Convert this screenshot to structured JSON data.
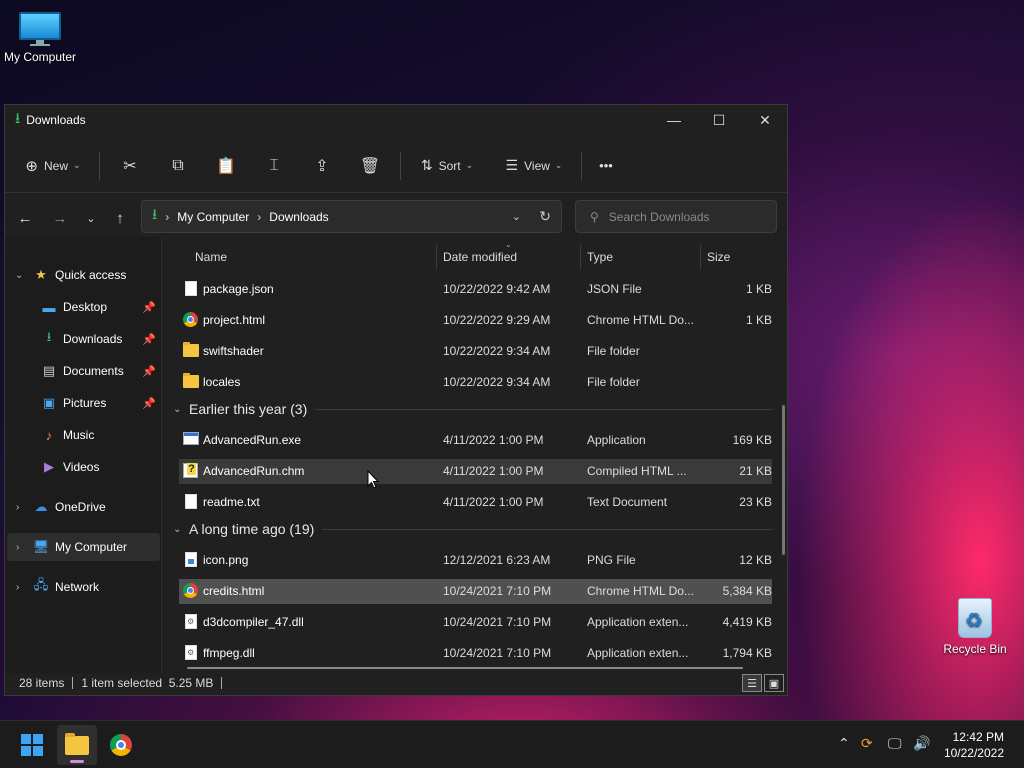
{
  "desktop": {
    "my_computer_label": "My Computer",
    "recycle_bin_label": "Recycle Bin"
  },
  "window": {
    "title": "Downloads",
    "controls": {
      "minimize": "—",
      "maximize": "☐",
      "close": "✕"
    }
  },
  "toolbar": {
    "new_label": "New",
    "sort_label": "Sort",
    "view_label": "View",
    "more_label": "•••"
  },
  "address": {
    "crumbs": [
      "My Computer",
      "Downloads"
    ],
    "separator": "›"
  },
  "search": {
    "placeholder": "Search Downloads"
  },
  "nav": {
    "quick_access": "Quick access",
    "items": [
      {
        "label": "Desktop",
        "icon": "desktop-icon",
        "pinned": true
      },
      {
        "label": "Downloads",
        "icon": "download-icon",
        "pinned": true
      },
      {
        "label": "Documents",
        "icon": "documents-icon",
        "pinned": true
      },
      {
        "label": "Pictures",
        "icon": "pictures-icon",
        "pinned": true
      },
      {
        "label": "Music",
        "icon": "music-icon",
        "pinned": false
      },
      {
        "label": "Videos",
        "icon": "videos-icon",
        "pinned": false
      }
    ],
    "onedrive": "OneDrive",
    "my_computer": "My Computer",
    "network": "Network"
  },
  "columns": {
    "name": "Name",
    "date": "Date modified",
    "type": "Type",
    "size": "Size"
  },
  "files_top": [
    {
      "name": "package.json",
      "date": "10/22/2022 9:42 AM",
      "type": "JSON File",
      "size": "1 KB",
      "icon": "doc"
    },
    {
      "name": "project.html",
      "date": "10/22/2022 9:29 AM",
      "type": "Chrome HTML Do...",
      "size": "1 KB",
      "icon": "chrome"
    },
    {
      "name": "swiftshader",
      "date": "10/22/2022 9:34 AM",
      "type": "File folder",
      "size": "",
      "icon": "folder"
    },
    {
      "name": "locales",
      "date": "10/22/2022 9:34 AM",
      "type": "File folder",
      "size": "",
      "icon": "folder"
    }
  ],
  "group_earlier": "Earlier this year (3)",
  "files_earlier": [
    {
      "name": "AdvancedRun.exe",
      "date": "4/11/2022 1:00 PM",
      "type": "Application",
      "size": "169 KB",
      "icon": "app"
    },
    {
      "name": "AdvancedRun.chm",
      "date": "4/11/2022 1:00 PM",
      "type": "Compiled HTML ...",
      "size": "21 KB",
      "icon": "chm"
    },
    {
      "name": "readme.txt",
      "date": "4/11/2022 1:00 PM",
      "type": "Text Document",
      "size": "23 KB",
      "icon": "doc"
    }
  ],
  "group_long": "A long time ago (19)",
  "files_long": [
    {
      "name": "icon.png",
      "date": "12/12/2021 6:23 AM",
      "type": "PNG File",
      "size": "12 KB",
      "icon": "img"
    },
    {
      "name": "credits.html",
      "date": "10/24/2021 7:10 PM",
      "type": "Chrome HTML Do...",
      "size": "5,384 KB",
      "icon": "chrome"
    },
    {
      "name": "d3dcompiler_47.dll",
      "date": "10/24/2021 7:10 PM",
      "type": "Application exten...",
      "size": "4,419 KB",
      "icon": "dll"
    },
    {
      "name": "ffmpeg.dll",
      "date": "10/24/2021 7:10 PM",
      "type": "Application exten...",
      "size": "1,794 KB",
      "icon": "dll"
    }
  ],
  "status": {
    "items": "28 items",
    "selected": "1 item selected  5.25 MB"
  },
  "taskbar": {
    "time": "12:42 PM",
    "date": "10/22/2022"
  }
}
